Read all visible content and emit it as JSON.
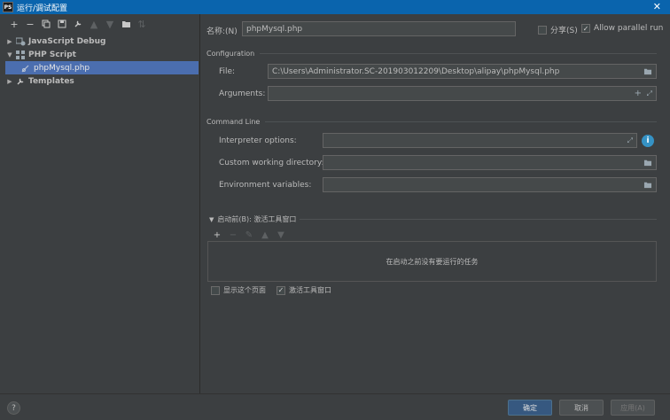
{
  "window": {
    "title": "运行/调试配置",
    "app_icon_text": "PS"
  },
  "toolbar": {
    "icons": [
      "plus-icon",
      "minus-icon",
      "copy-icon",
      "save-icon",
      "wrench-icon",
      "arrow-up-icon",
      "arrow-down-icon",
      "folder-icon",
      "sort-icon"
    ]
  },
  "tree": {
    "items": [
      {
        "label": "JavaScript Debug",
        "expanded": false
      },
      {
        "label": "PHP Script",
        "expanded": true,
        "children": [
          "phpMysql.php"
        ]
      },
      {
        "label": "Templates",
        "expanded": false
      }
    ]
  },
  "form": {
    "name_label": "名称:(N)",
    "name_value": "phpMysql.php",
    "share_label": "分享(S)",
    "share_checked": false,
    "parallel_label": "Allow parallel run",
    "parallel_checked": true,
    "configuration_title": "Configuration",
    "file_label": "File:",
    "file_value": "C:\\Users\\Administrator.SC-201903012209\\Desktop\\alipay\\phpMysql.php",
    "arguments_label": "Arguments:",
    "arguments_value": "",
    "command_line_title": "Command Line",
    "interpreter_label": "Interpreter options:",
    "working_dir_label": "Custom working directory:",
    "env_label": "Environment variables:",
    "before_launch_title": "启动前(B): 激活工具窗口",
    "task_empty_text": "在启动之前没有要运行的任务",
    "show_page_label": "显示这个页面",
    "show_page_checked": false,
    "activate_window_label": "激活工具窗口",
    "activate_window_checked": true
  },
  "buttons": {
    "ok": "确定",
    "cancel": "取消",
    "apply": "应用(A)",
    "help": "?"
  },
  "colors": {
    "title_bar": "#0a64ad",
    "background": "#3c3f41",
    "selection": "#4b6eaf",
    "primary_button": "#365880"
  }
}
